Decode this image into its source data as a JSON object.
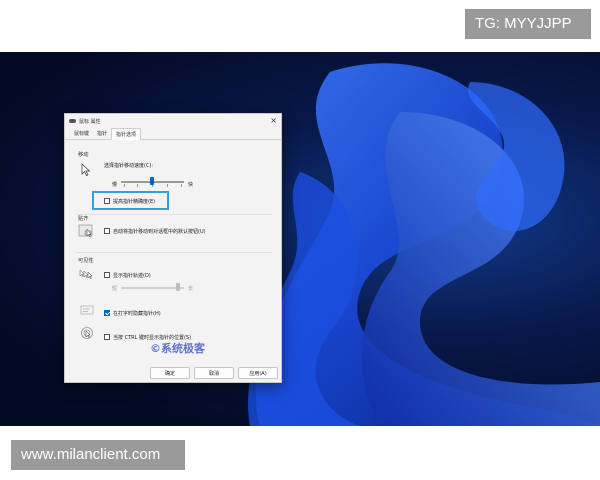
{
  "overlay": {
    "top_badge": "TG: MYYJJPP",
    "bottom_badge": "www.milanclient.com"
  },
  "dialog": {
    "title": "鼠标 属性",
    "tabs": [
      {
        "label": "鼠标键",
        "active": false
      },
      {
        "label": "指针",
        "active": false
      },
      {
        "label": "指针选项",
        "active": true
      }
    ],
    "motion": {
      "section_title": "移动",
      "speed_label": "选择指针移动速度(C):",
      "slow_label": "慢",
      "fast_label": "快",
      "speed_level": 0.5,
      "precision_label": "提高指针精确度(E)",
      "precision_checked": false
    },
    "snap_to": {
      "section_title": "贴齐",
      "label": "自动将指针移动到对话框中的默认按钮(U)",
      "checked": false
    },
    "visibility": {
      "section_title": "可见性",
      "trails_label": "显示指针轨迹(D)",
      "trails_checked": false,
      "trails_short": "短",
      "trails_long": "长",
      "hide_typing_label": "在打字时隐藏指针(H)",
      "hide_typing_checked": true,
      "ctrl_label": "当按 CTRL 键时显示指针的位置(S)",
      "ctrl_checked": false
    },
    "buttons": {
      "ok": "确定",
      "cancel": "取消",
      "apply": "应用(A)"
    }
  },
  "watermark": "系统极客",
  "colors": {
    "accent": "#0067c0",
    "highlight": "#2ea2e0"
  }
}
